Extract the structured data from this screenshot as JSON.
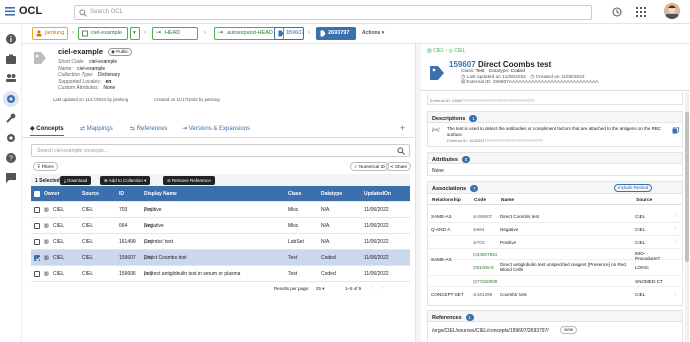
{
  "header": {
    "logo_text": "OCL",
    "search_placeholder": "Search OCL"
  },
  "breadcrumbs": [
    {
      "label": "jamlung",
      "style": "orange"
    },
    {
      "label": "ciel-example",
      "style": "green"
    },
    {
      "label": "HEAD",
      "style": "green"
    },
    {
      "label": "autoexpand-HEAD",
      "style": "green"
    },
    {
      "label": "159607",
      "style": "blueo"
    },
    {
      "label": "2693797",
      "style": "blue"
    },
    {
      "label": "Actions",
      "style": "text"
    }
  ],
  "collection": {
    "name": "ciel-example",
    "visibility": "Public",
    "fields": [
      {
        "label": "Short Code:",
        "value": "ciel-example"
      },
      {
        "label": "Name:",
        "value": "ciel-example"
      },
      {
        "label": "Collection Type:",
        "value": "Dictionary"
      },
      {
        "label": "Supported Locales:",
        "value": "en"
      },
      {
        "label": "Custom Attributes:",
        "value": "None"
      }
    ],
    "updated": "Last updated on 11/17/2022 by jamlung",
    "created": "Created on 11/17/2022 by jamlung"
  },
  "tabs": [
    {
      "label": "Concepts",
      "active": true
    },
    {
      "label": "Mappings",
      "active": false
    },
    {
      "label": "References",
      "active": false
    },
    {
      "label": "Versions & Expansions",
      "active": false
    }
  ],
  "search": {
    "placeholder": "Search ciel-example concepts..."
  },
  "filters": {
    "label": "Filters",
    "numerical_id": "Numerical ID",
    "share": "Share"
  },
  "toolbar": {
    "selected": "1 Selected",
    "download": "Download",
    "add_to_collection": "Add to Collection",
    "remove_reference": "Remove Reference"
  },
  "table": {
    "headers": [
      "Owner",
      "Source",
      "ID",
      "Display Name",
      "Class",
      "Datatype",
      "UpdatedOn"
    ],
    "rows": [
      {
        "owner": "CIEL",
        "source": "CIEL",
        "id": "703",
        "name": "Positive",
        "locale": "[en]",
        "class": "Misc",
        "datatype": "N/A",
        "updated": "11/06/2022",
        "selected": false
      },
      {
        "owner": "CIEL",
        "source": "CIEL",
        "id": "664",
        "name": "Negative",
        "locale": "[en]",
        "class": "Misc",
        "datatype": "N/A",
        "updated": "11/06/2022",
        "selected": false
      },
      {
        "owner": "CIEL",
        "source": "CIEL",
        "id": "161499",
        "name": "Coombs' test",
        "locale": "[en]",
        "class": "LabSet",
        "datatype": "N/A",
        "updated": "11/06/2022",
        "selected": false
      },
      {
        "owner": "CIEL",
        "source": "CIEL",
        "id": "159607",
        "name": "Direct Coombs test",
        "locale": "[en]",
        "class": "Test",
        "datatype": "Coded",
        "updated": "11/06/2022",
        "selected": true
      },
      {
        "owner": "CIEL",
        "source": "CIEL",
        "id": "159606",
        "name": "Indirect antiglobulin test in serum or plasma",
        "locale": "[en]",
        "class": "Test",
        "datatype": "Coded",
        "updated": "11/06/2022",
        "selected": false
      }
    ],
    "pagination": {
      "rows_per_page_label": "Results per page:",
      "rows_per_page": "25",
      "range": "1–5 of 5"
    }
  },
  "detail": {
    "breadcrumb": [
      "CIEL",
      "CIEL"
    ],
    "id": "159607",
    "title": "Direct Coombs test",
    "class_label": "Class:",
    "class_value": "Test",
    "datatype_label": "Datatype:",
    "datatype_value": "Coded",
    "last_updated": "Last updated on 11/06/2022",
    "created": "Created on 11/06/2022",
    "external_id": "External ID: 159607AAAAAAAAAAAAAAAAAAAAAAAAAAAA",
    "external_id_short": "External ID: 1366?????????????????????????????????",
    "descriptions_title": "Descriptions",
    "descriptions_count": "1",
    "description_locale": "[en]",
    "description_text": "The test is used to detect the antibodies or compliment factors that are attached to the antigens on the RBC surface.",
    "description_extid": "External ID: 1625331??????????????????????????",
    "attributes_title": "Attributes",
    "attributes_count": "0",
    "attributes_none": "None",
    "associations_title": "Associations",
    "associations_count": "7",
    "include_retired": "Include Retired",
    "assoc_headers": [
      "Relationship",
      "Code",
      "Name",
      "Source"
    ],
    "associations": [
      {
        "rel": "SAME-AS",
        "code": "159607",
        "name": "Direct Coombs test",
        "source": "CIEL"
      },
      {
        "rel": "Q-AND-A",
        "code": "664",
        "name": "Negative",
        "source": "CIEL"
      },
      {
        "rel": "",
        "code": "703",
        "name": "Positive",
        "source": "CIEL"
      },
      {
        "rel": "SAME-AS",
        "code": "34807851",
        "name": "",
        "source": "IMO-ProcedureIT"
      },
      {
        "rel": "",
        "code": "51006-5",
        "name": "Direct antiglobulin test unspecified reagent [Presence] on Red Blood Cells",
        "source": "LOINC"
      },
      {
        "rel": "",
        "code": "77020008",
        "name": "",
        "source": "SNOMED-CT"
      },
      {
        "rel": "CONCEPT-SET",
        "code": "161499",
        "name": "Coombs' test",
        "source": "CIEL"
      }
    ],
    "references_title": "References",
    "references_count": "1",
    "reference_path": "/orgs/CIEL/sources/CIEL/concepts/159607/2693797/",
    "reference_view": "view"
  },
  "colors": {
    "primary": "#3b6fae",
    "green": "#4caf50",
    "orange": "#f5a623",
    "selected": "#c9d8ec"
  }
}
